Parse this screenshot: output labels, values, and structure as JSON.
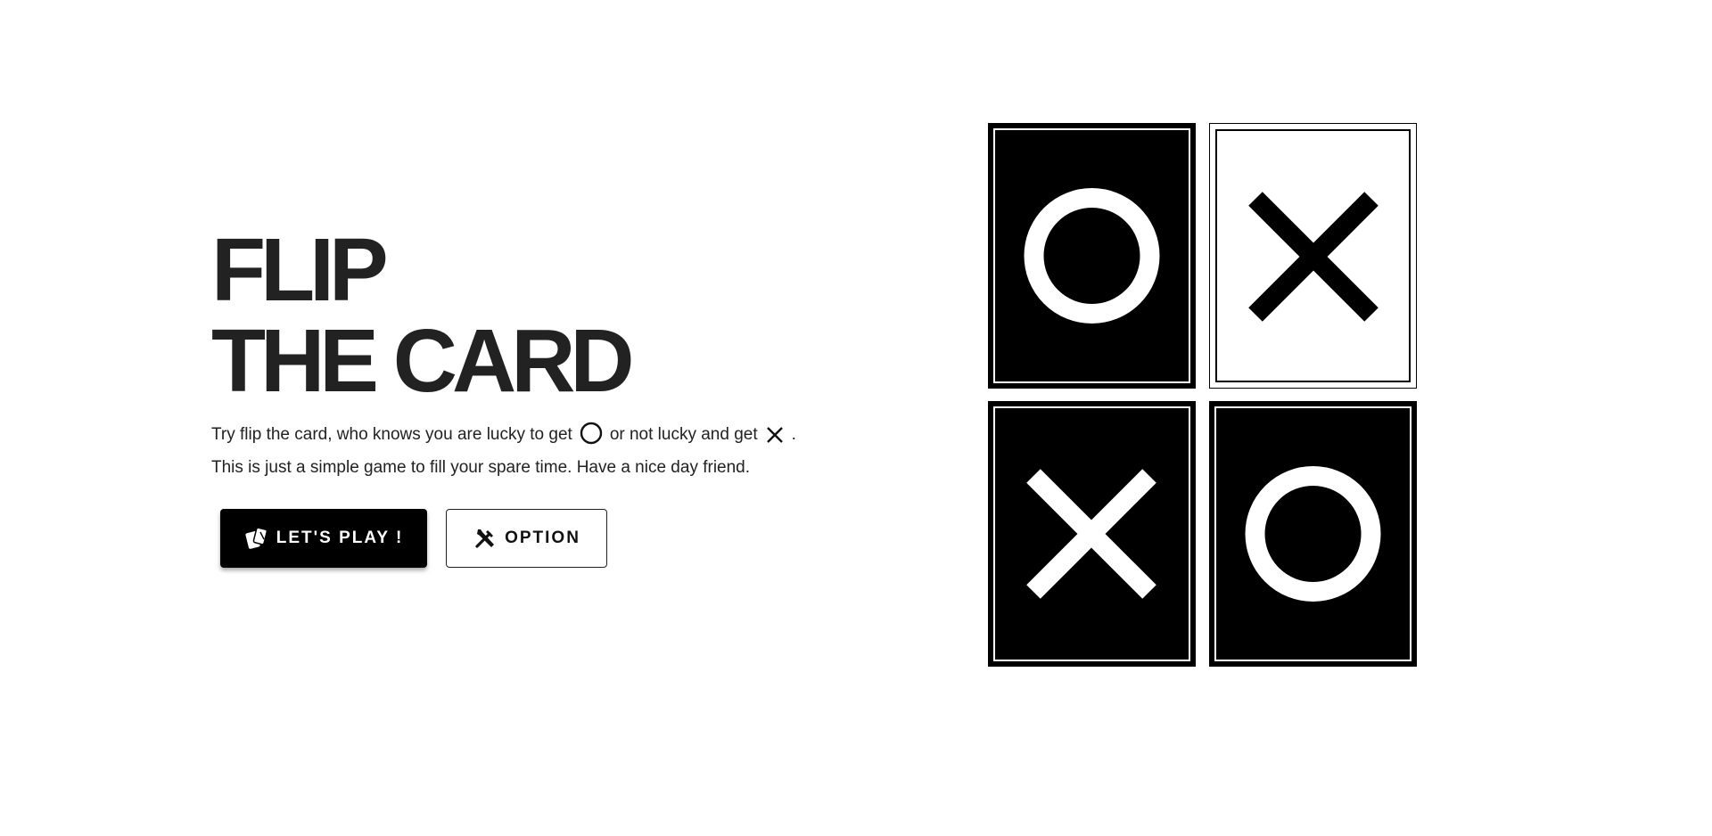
{
  "hero": {
    "title_line1": "FLIP",
    "title_line2": "THE CARD",
    "desc_part1": "Try flip the card, who knows you are lucky to get",
    "desc_part2": "or not lucky and get",
    "desc_part3": ".",
    "desc_line2": "This is just a simple game to fill your spare time. Have a nice day friend.",
    "lucky_icon": "circle-icon",
    "unlucky_icon": "cross-icon"
  },
  "buttons": {
    "play_label": "LET'S PLAY !",
    "play_icon": "cards-icon",
    "option_label": "OPTION",
    "option_icon": "tools-icon"
  },
  "cards": [
    {
      "symbol": "O",
      "style": "dark"
    },
    {
      "symbol": "X",
      "style": "light"
    },
    {
      "symbol": "X",
      "style": "dark"
    },
    {
      "symbol": "O",
      "style": "dark"
    }
  ],
  "colors": {
    "text": "#222222",
    "card_dark": "#000000",
    "card_light": "#ffffff"
  }
}
